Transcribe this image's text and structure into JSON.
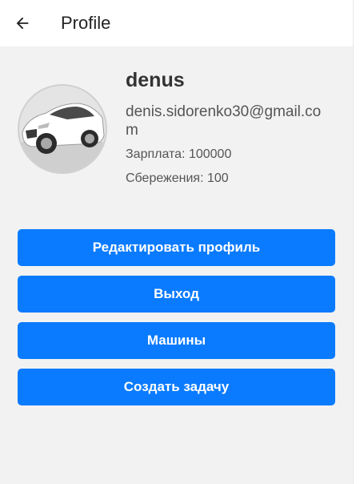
{
  "header": {
    "title": "Profile",
    "back_icon": "arrow-left-icon"
  },
  "profile": {
    "name": "denus",
    "email": "denis.sidorenko30@gmail.com",
    "salary_label": "Зарплата: 100000",
    "savings_label": "Сбережения: 100",
    "avatar": "car-photo"
  },
  "actions": {
    "edit_profile": "Редактировать профиль",
    "logout": "Выход",
    "cars": "Машины",
    "create_task": "Создать задачу"
  },
  "colors": {
    "accent": "#0a7bff",
    "background": "#f2f2f2",
    "appbar": "#ffffff"
  }
}
